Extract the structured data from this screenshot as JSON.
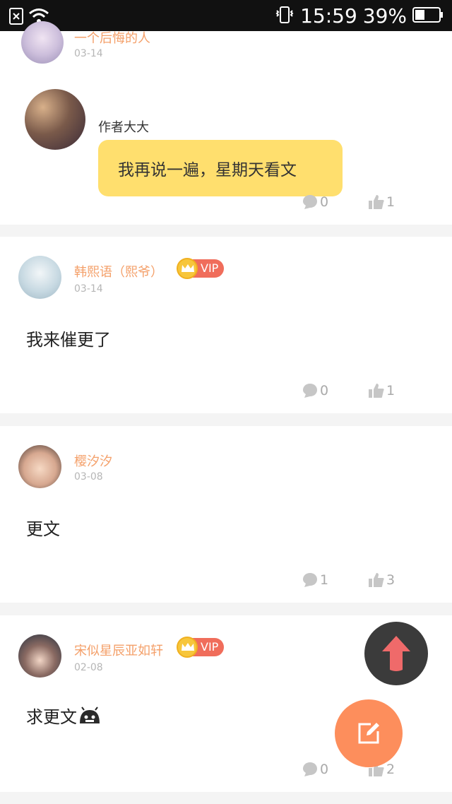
{
  "status_bar": {
    "time": "15:59",
    "battery": "39%"
  },
  "comments": [
    {
      "username": "一个后悔的人",
      "date": "03-14",
      "reply_label": "作者大大",
      "reply_text": "我再说一遍，星期天看文",
      "comments_count": "0",
      "likes_count": "1"
    },
    {
      "username": "韩熙语（熙爷）",
      "vip": "VIP",
      "date": "03-14",
      "text": "我来催更了",
      "comments_count": "0",
      "likes_count": "1"
    },
    {
      "username": "樱汐汐",
      "date": "03-08",
      "text": "更文",
      "comments_count": "1",
      "likes_count": "3"
    },
    {
      "username": "宋似星辰亚如轩",
      "vip": "VIP",
      "date": "02-08",
      "text": "求更文",
      "comments_count": "0",
      "likes_count": "2"
    }
  ],
  "colors": {
    "accent": "#f4a06a",
    "bubble": "#ffdf6e",
    "fab_edit": "#fd8e5c",
    "fab_up": "#3b3b3b",
    "vip": "#f06d5b"
  },
  "icons": [
    "sim-icon",
    "wifi-icon",
    "vibrate-icon",
    "battery-icon",
    "comment-icon",
    "thumbs-up-icon",
    "arrow-up-icon",
    "edit-icon",
    "crown-icon",
    "robot-emoji-icon"
  ]
}
